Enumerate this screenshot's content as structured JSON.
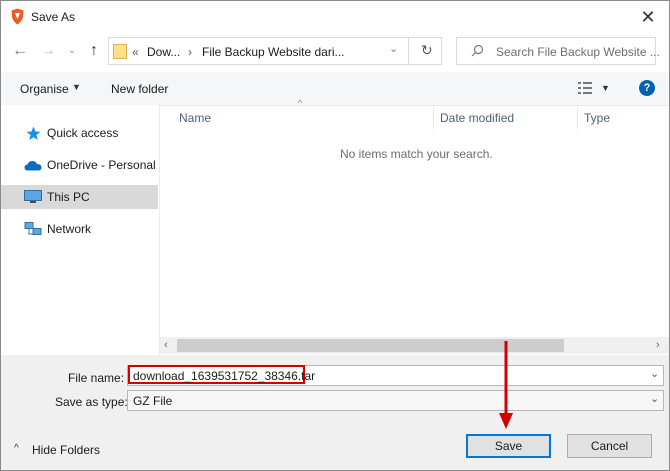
{
  "window": {
    "title": "Save As",
    "close_label": "✕"
  },
  "address": {
    "path_prefix": "«",
    "crumb1": "Dow...",
    "crumb_sep": "›",
    "crumb2": "File Backup Website dari...",
    "search_placeholder": "Search File Backup Website ..."
  },
  "toolbar": {
    "organise_label": "Organise",
    "new_folder_label": "New folder",
    "help_label": "?"
  },
  "sidebar": {
    "items": [
      {
        "label": "Quick access",
        "icon": "star-icon"
      },
      {
        "label": "OneDrive - Personal",
        "icon": "cloud-icon"
      },
      {
        "label": "This PC",
        "icon": "monitor-icon",
        "selected": true
      },
      {
        "label": "Network",
        "icon": "network-icon"
      }
    ]
  },
  "content": {
    "columns": [
      "Name",
      "Date modified",
      "Type"
    ],
    "empty_message": "No items match your search."
  },
  "form": {
    "filename_label": "File name:",
    "filename_value": "download_1639531752_38346.tar",
    "savetype_label": "Save as type:",
    "savetype_value": "GZ File"
  },
  "footer": {
    "hide_folders_label": "Hide Folders",
    "save_label": "Save",
    "cancel_label": "Cancel"
  },
  "colors": {
    "accent": "#0078d7",
    "annotation": "#d40000",
    "help_icon": "#0063b1"
  }
}
